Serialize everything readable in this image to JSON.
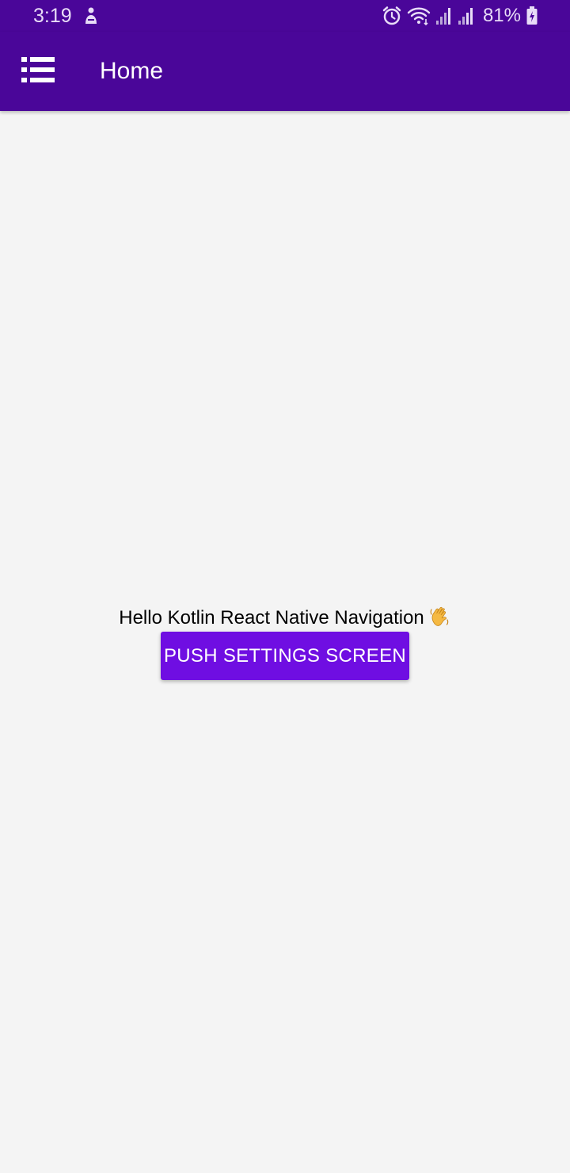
{
  "status_bar": {
    "time": "3:19",
    "battery_percent": "81%",
    "icons": [
      "person-notification-icon",
      "alarm-icon",
      "wifi-icon",
      "signal-icon",
      "signal-icon-2",
      "battery-charging-icon"
    ]
  },
  "toolbar": {
    "title": "Home",
    "menu_icon": "list-menu-icon",
    "background_color": "#4a0699"
  },
  "main": {
    "greeting": "Hello Kotlin React Native Navigation",
    "greeting_icon": "waving-hand-icon",
    "push_button_label": "PUSH SETTINGS SCREEN",
    "button_color": "#6f0ee2"
  }
}
